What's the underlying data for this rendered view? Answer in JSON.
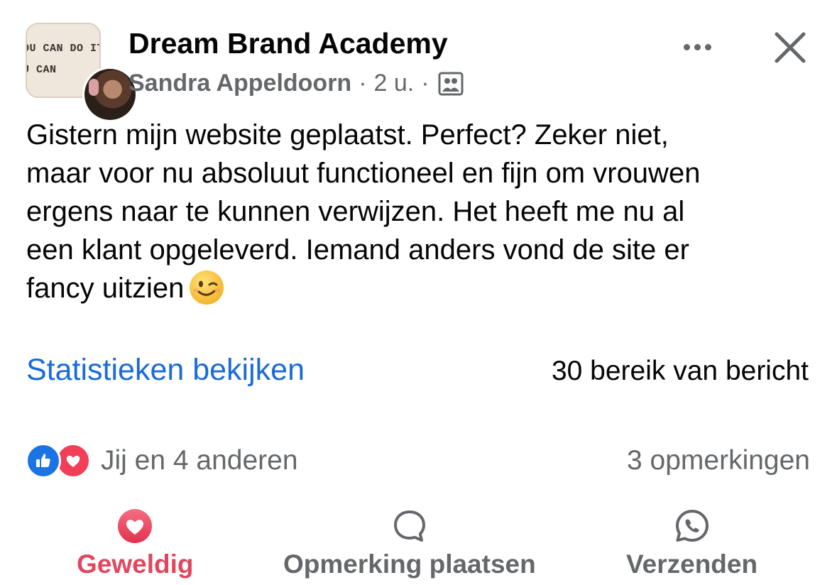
{
  "header": {
    "group_name": "Dream Brand Academy",
    "author": "Sandra Appeldoorn",
    "time": "2 u.",
    "separator": "·",
    "avatar_text_line1": "OU CAN DO IT",
    "avatar_text_line2": "U CAN",
    "icons": {
      "more": "more-dots-icon",
      "close": "close-icon",
      "audience": "group-members-icon"
    }
  },
  "post": {
    "lines": [
      "Gistern mijn website geplaatst. Perfect? Zeker niet,",
      "maar voor nu absoluut functioneel en fijn om vrouwen",
      "ergens naar te kunnen verwijzen. Het heeft me nu al",
      "een klant opgeleverd. Iemand anders vond de site er",
      "fancy uitzien"
    ],
    "emoji": "winking-face-emoji"
  },
  "insights": {
    "link_label": "Statistieken bekijken",
    "reach_label": "30 bereik van bericht"
  },
  "reactions": {
    "summary": "Jij en 4 anderen",
    "comments": "3 opmerkingen",
    "types": [
      "like",
      "love"
    ]
  },
  "actions": {
    "love_label": "Geweldig",
    "comment_label": "Opmerking plaatsen",
    "send_label": "Verzenden"
  },
  "colors": {
    "link_blue": "#1b6bd6",
    "love_red": "#e0475e",
    "like_blue": "#1b74e4",
    "secondary_gray": "#65676b",
    "text_black": "#050505"
  }
}
